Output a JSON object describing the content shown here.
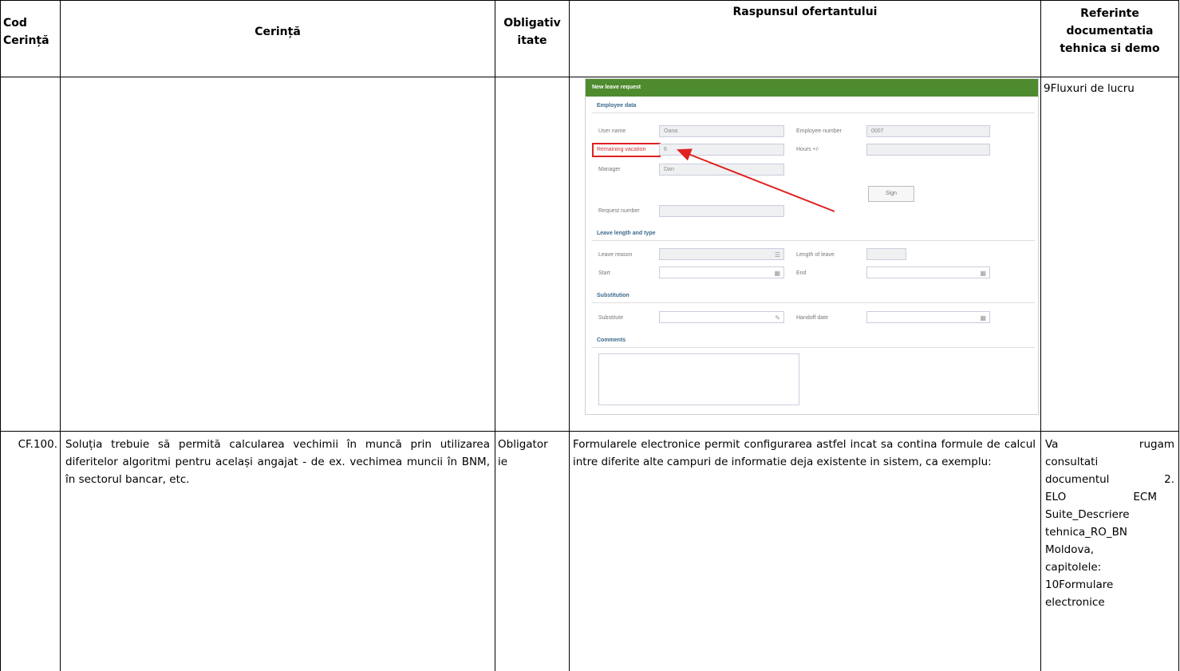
{
  "header": {
    "col1": [
      "Cod",
      "Cerință"
    ],
    "col2": "Cerință",
    "col3": [
      "Obligativ",
      "itate"
    ],
    "col4": "Raspunsul ofertantului",
    "col5": [
      "Referinte",
      "documentatia",
      "tehnica si demo"
    ]
  },
  "row1": {
    "ref": "9Fluxuri de lucru"
  },
  "form": {
    "title": "New leave request",
    "sections": {
      "employee": "Employee data",
      "leave": "Leave length and type",
      "substitution": "Substitution",
      "comments": "Comments"
    },
    "labels": {
      "user_name": "User name",
      "employee_number": "Employee number",
      "remaining_vacation": "Remaining vacation",
      "hours": "Hours +/-",
      "manager": "Manager",
      "request_number": "Request number",
      "leave_reason": "Leave reason",
      "length_of_leave": "Length of leave",
      "start": "Start",
      "end": "End",
      "substitute": "Substitute",
      "handoff_date": "Handoff date"
    },
    "values": {
      "user_name": "Oana",
      "employee_number": "0007",
      "remaining_vacation": "6",
      "manager": "Dan"
    },
    "sign_button": "Sign",
    "accent_color": "#4e8a2e",
    "highlight_color": "#e02020"
  },
  "row2": {
    "code": "CF.100.",
    "requirement": "Soluția trebuie să permită calcularea vechimii în muncă prin utilizarea diferitelor algoritmi pentru același angajat - de ex. vechimea muncii în BNM, în sectorul bancar, etc.",
    "mandatory": [
      "Obligator",
      "ie"
    ],
    "response": "Formularele electronice permit configurarea astfel incat sa contina formule de calcul intre diferite alte campuri de informatie deja existente in sistem, ca exemplu:",
    "ref_lines": [
      "Va rugam",
      "consultati",
      "documentul 2.",
      "ELO ECM",
      "Suite_Descriere",
      "tehnica_RO_BN",
      "Moldova,",
      "capitolele:",
      "10Formulare",
      "electronice"
    ]
  }
}
